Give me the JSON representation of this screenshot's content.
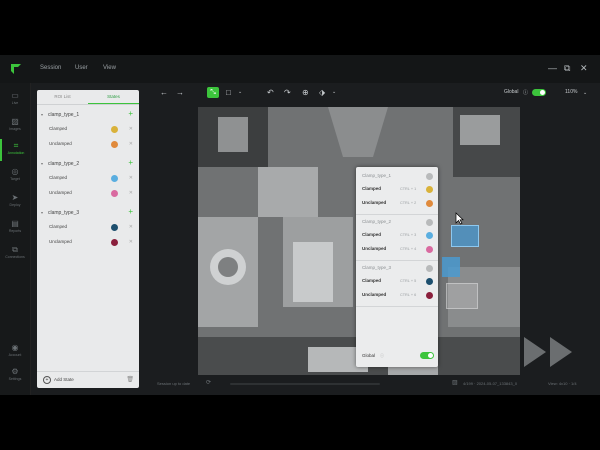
{
  "menubar": {
    "items": [
      "Session",
      "User",
      "View"
    ],
    "window_controls": [
      "—",
      "⧉",
      "✕"
    ]
  },
  "rail": {
    "items": [
      {
        "label": "Live",
        "icon": "camera-icon",
        "active": false
      },
      {
        "label": "Images",
        "icon": "image-icon",
        "active": false
      },
      {
        "label": "Annotation",
        "icon": "crop-icon",
        "active": true
      },
      {
        "label": "Target",
        "icon": "target-icon",
        "active": false
      },
      {
        "label": "Deploy",
        "icon": "send-icon",
        "active": false
      },
      {
        "label": "Reports",
        "icon": "clipboard-icon",
        "active": false
      },
      {
        "label": "Connections",
        "icon": "connection-icon",
        "active": false
      }
    ],
    "bottom_items": [
      {
        "label": "Account",
        "icon": "account-icon"
      },
      {
        "label": "Settings",
        "icon": "gear-icon"
      }
    ]
  },
  "panel": {
    "tabs": [
      {
        "label": "ROI List",
        "active": false
      },
      {
        "label": "States",
        "active": true
      }
    ],
    "groups": [
      {
        "name": "clamp_type_1",
        "states": [
          {
            "name": "Clamped",
            "color": "#d9b23a"
          },
          {
            "name": "Unclamped",
            "color": "#e08a3c"
          }
        ]
      },
      {
        "name": "clamp_type_2",
        "states": [
          {
            "name": "Clamped",
            "color": "#5aaee0"
          },
          {
            "name": "Unclamped",
            "color": "#d96aa0"
          }
        ]
      },
      {
        "name": "clamp_type_3",
        "states": [
          {
            "name": "Clamped",
            "color": "#1d4f6e"
          },
          {
            "name": "Unclamped",
            "color": "#8a1f3c"
          }
        ]
      }
    ],
    "add_state_label": "Add State"
  },
  "toolbar": {
    "global_label": "Global",
    "zoom": "110%"
  },
  "popup": {
    "groups": [
      {
        "title": "Clamp_type_1",
        "rows": [
          {
            "name": "Clamped",
            "shortcut": "CTRL + 1",
            "color": "#d9b23a"
          },
          {
            "name": "Unclamped",
            "shortcut": "CTRL + 2",
            "color": "#e08a3c"
          }
        ]
      },
      {
        "title": "Clamp_type_2",
        "rows": [
          {
            "name": "Clamped",
            "shortcut": "CTRL + 3",
            "color": "#5aaee0"
          },
          {
            "name": "Unclamped",
            "shortcut": "CTRL + 4",
            "color": "#d96aa0"
          }
        ]
      },
      {
        "title": "Clamp_type_3",
        "rows": [
          {
            "name": "Clamped",
            "shortcut": "CTRL + 5",
            "color": "#1d4f6e"
          },
          {
            "name": "Unclamped",
            "shortcut": "CTRL + 6",
            "color": "#8a1f3c"
          }
        ]
      }
    ],
    "global_label": "Global"
  },
  "status": {
    "session": "Session up to date",
    "image_info": "4/199 · 2024-05-07_133843_0",
    "view": "View: 4x10 · 1/4"
  },
  "colors": {
    "accent": "#3cc43c",
    "roi_highlight": "#4a9ad0"
  }
}
